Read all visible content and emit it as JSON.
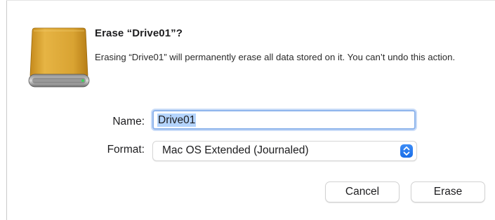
{
  "dialog": {
    "icon": "external-drive-icon",
    "title": "Erase “Drive01”?",
    "message": "Erasing “Drive01” will permanently erase all data stored on it. You can’t undo this action.",
    "name_label": "Name:",
    "name_value": "Drive01",
    "format_label": "Format:",
    "format_value": "Mac OS Extended (Journaled)",
    "select_icon": "up-down-chevron-icon",
    "cancel_label": "Cancel",
    "erase_label": "Erase"
  },
  "colors": {
    "accent": "#1a6ee8",
    "drive_body": "#d8a32e",
    "selection": "#b4d4fd"
  }
}
